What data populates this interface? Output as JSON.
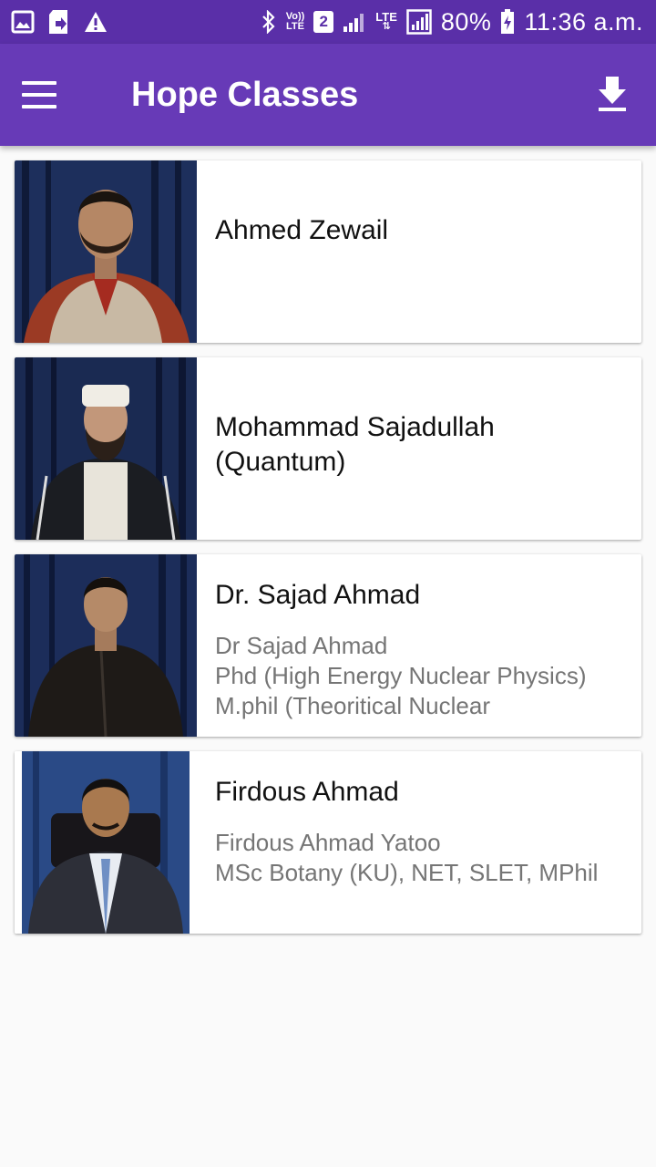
{
  "status_bar": {
    "lte_top": "Vo))",
    "lte_bottom": "LTE",
    "sim_number": "2",
    "lte_top2": "LTE",
    "battery": "80%",
    "time": "11:36 a.m."
  },
  "app_bar": {
    "title": "Hope Classes"
  },
  "teachers": [
    {
      "name": "Ahmed Zewail",
      "description": ""
    },
    {
      "name": "Mohammad Sajadullah\n(Quantum)",
      "description": ""
    },
    {
      "name": "Dr. Sajad Ahmad",
      "description": "Dr Sajad Ahmad\nPhd (High Energy Nuclear Physics)\nM.phil (Theoritical Nuclear"
    },
    {
      "name": "Firdous Ahmad",
      "description": "Firdous Ahmad Yatoo\nMSc Botany (KU), NET, SLET, MPhil"
    }
  ],
  "colors": {
    "status_bar": "#5a2fa8",
    "app_bar": "#673ab7",
    "background": "#fafafa"
  }
}
